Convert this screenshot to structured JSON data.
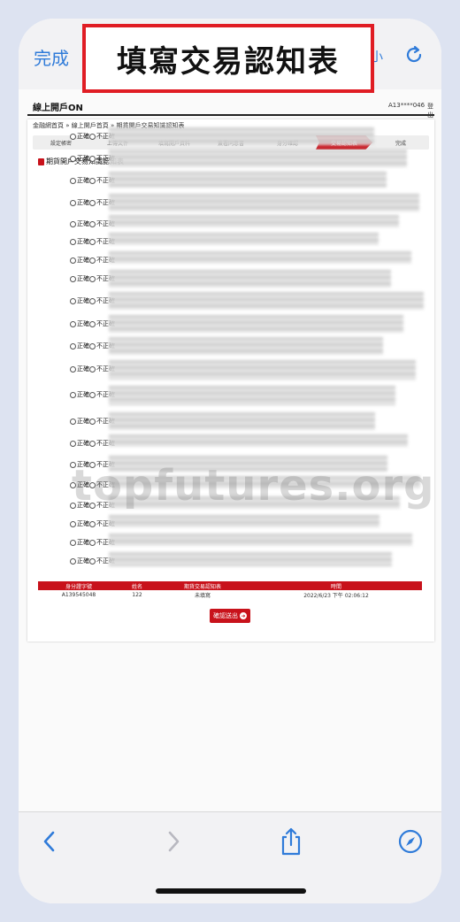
{
  "browser": {
    "done_label": "完成",
    "text_size_label": "小"
  },
  "banner": {
    "title": "填寫交易認知表"
  },
  "site": {
    "name": "線上開戶ON",
    "user_id": "A13****046",
    "logout_label": "登出"
  },
  "breadcrumb": "金融網首頁 » 線上開戶首頁 » 期貨開戶交易知識認知表",
  "steps": [
    "設定帳密",
    "上傳文件",
    "填寫開戶資料",
    "簽署同意書",
    "身分確認",
    "交易認知表",
    "完成"
  ],
  "active_step": 5,
  "form": {
    "heading": "期貨開戶交易知識認知表",
    "option_correct": "正確",
    "option_incorrect": "不正確",
    "question_count": 21
  },
  "result_table": {
    "headers": [
      "身分證字號",
      "姓名",
      "期貨交易認知表",
      "時間"
    ],
    "row": [
      "A139545048",
      "122",
      "未填寫",
      "2022/6/23 下午 02:06:12"
    ]
  },
  "submit_label": "確認送出",
  "watermark": "topfutures.org",
  "colors": {
    "accent": "#c8121b",
    "link": "#2f7bd9",
    "banner_border": "#e01d24"
  },
  "icons": [
    "reload-icon",
    "back-icon",
    "forward-icon",
    "share-icon",
    "compass-icon",
    "arrow-right-circle-icon",
    "document-icon"
  ]
}
